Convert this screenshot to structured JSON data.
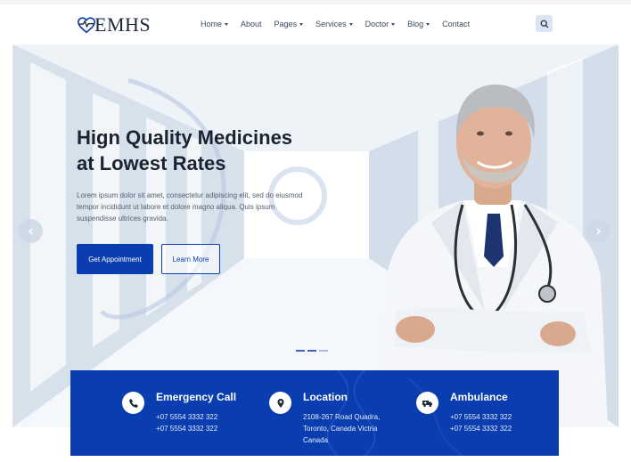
{
  "header": {
    "logo_text": "EMHS",
    "nav": [
      {
        "label": "Home",
        "dropdown": true
      },
      {
        "label": "About",
        "dropdown": false
      },
      {
        "label": "Pages",
        "dropdown": true
      },
      {
        "label": "Services",
        "dropdown": true
      },
      {
        "label": "Doctor",
        "dropdown": true
      },
      {
        "label": "Blog",
        "dropdown": true
      },
      {
        "label": "Contact",
        "dropdown": false
      }
    ],
    "search_icon": "search-icon"
  },
  "hero": {
    "title_line1": "Hign Quality Medicines",
    "title_line2": "at Lowest Rates",
    "text_line1": "Lorem ipsum dolor sit amet, consectetur adipiscing elit, sed do eiusmod",
    "text_line2": "tempor incididunt ut labore et dolore magno aliqua. Quis ipsum",
    "text_line3": "suspendisse ultrices gravida.",
    "primary_button": "Get Appointment",
    "secondary_button": "Learn More",
    "slides": 3,
    "active_slide": 1
  },
  "info": {
    "emergency": {
      "title": "Emergency Call",
      "line1": "+07 5554 3332 322",
      "line2": "+07 5554 3332 322",
      "icon": "phone-icon"
    },
    "location": {
      "title": "Location",
      "line1": "2108-267 Road Quadra,",
      "line2": "Toronto, Canada Victria",
      "line3": "Canada",
      "icon": "map-pin-icon"
    },
    "ambulance": {
      "title": "Ambulance",
      "line1": "+07 5554 3332 322",
      "line2": "+07 5554 3332 322",
      "icon": "ambulance-icon"
    }
  },
  "colors": {
    "brand": "#0a3db0",
    "title": "#1b2230",
    "nav": "#3a4a5e"
  }
}
